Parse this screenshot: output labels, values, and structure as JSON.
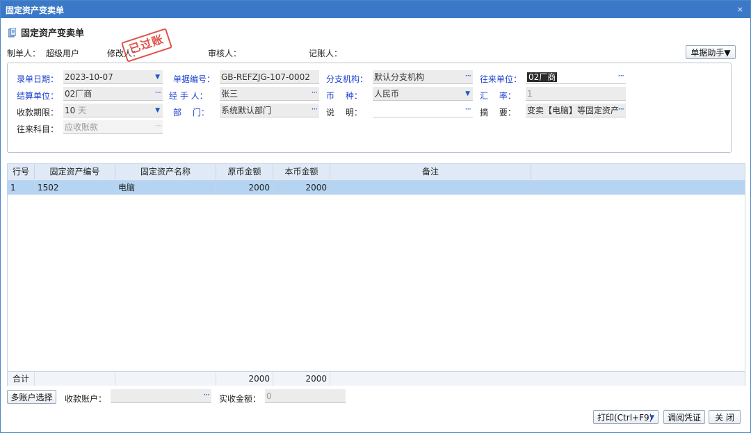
{
  "window": {
    "title": "固定资产变卖单",
    "close_glyph": "×"
  },
  "doc_title": "固定资产变卖单",
  "meta": {
    "maker_label": "制单人：",
    "maker_value": "超级用户",
    "modifier_label": "修改人：",
    "reviewer_label": "审核人：",
    "poster_label": "记账人："
  },
  "stamp_text": "已过账",
  "helper_button": "单据助手▼",
  "form": {
    "entry_date": {
      "label": "录单日期：",
      "value": "2023-10-07"
    },
    "doc_no": {
      "label": "单据编号：",
      "value": "GB-REFZJG-107-0002"
    },
    "branch": {
      "label": "分支机构：",
      "value": "默认分支机构"
    },
    "partner": {
      "label": "往来单位：",
      "value": "02厂商"
    },
    "settle_unit": {
      "label": "结算单位：",
      "value": "02厂商"
    },
    "handler": {
      "label": "经 手 人：",
      "value": "张三"
    },
    "currency": {
      "label": "币　 种：",
      "value": "人民币"
    },
    "rate": {
      "label": "汇　 率：",
      "value": "1"
    },
    "collect_period": {
      "label": "收款期限：",
      "value": "10",
      "unit": "天"
    },
    "dept": {
      "label": "部　 门：",
      "value": "系统默认部门"
    },
    "remark": {
      "label": "说　 明：",
      "value": ""
    },
    "summary": {
      "label": "摘　 要：",
      "value": "变卖【电脑】等固定资产"
    },
    "account_subject": {
      "label": "往来科目：",
      "value": "应收账款"
    }
  },
  "grid": {
    "columns": [
      "行号",
      "固定资产编号",
      "固定资产名称",
      "原币金额",
      "本币金额",
      "备注"
    ],
    "rows": [
      {
        "line": "1",
        "asset_no": "1502",
        "asset_name": "电脑",
        "orig_amount": "2000",
        "local_amount": "2000",
        "note": ""
      }
    ],
    "total": {
      "label": "合计",
      "orig_amount": "2000",
      "local_amount": "2000"
    }
  },
  "bottom": {
    "multi_account_button": "多账户选择",
    "receive_account_label": "收款账户：",
    "receive_account_value": "",
    "actual_amount_label": "实收金额：",
    "actual_amount_value": "0"
  },
  "footer": {
    "print_button": "打印(Ctrl+F9)",
    "view_voucher_button": "调阅凭证",
    "close_button": "关 闭"
  },
  "colors": {
    "titlebar": "#3b79c8",
    "label_blue": "#1a3fd1",
    "stamp_red": "#d9342b",
    "selected_row": "#b4d4f2"
  }
}
